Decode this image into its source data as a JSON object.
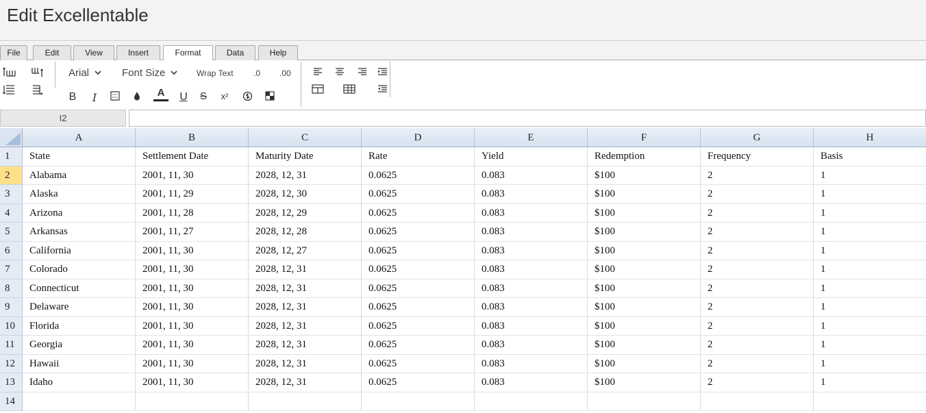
{
  "app": {
    "title": "Edit Excellentable"
  },
  "menu": {
    "tabs": [
      {
        "label": "File"
      },
      {
        "label": "Edit"
      },
      {
        "label": "View"
      },
      {
        "label": "Insert"
      },
      {
        "label": "Format",
        "active": true
      },
      {
        "label": "Data"
      },
      {
        "label": "Help"
      }
    ]
  },
  "toolbar": {
    "font_family": "Arial",
    "font_size": "Font Size",
    "wrap_text": "Wrap Text",
    "decrease_decimal": ".0",
    "increase_decimal": ".00",
    "bold": "B",
    "italic": "I",
    "font_color": "A",
    "underline": "U",
    "strikethrough": "S",
    "superscript": "x²"
  },
  "formula_bar": {
    "cell_ref": "I2",
    "value": ""
  },
  "sheet": {
    "columns": [
      "A",
      "B",
      "C",
      "D",
      "E",
      "F",
      "G",
      "H"
    ],
    "row_numbers": [
      "1",
      "2",
      "3",
      "4",
      "5",
      "6",
      "7",
      "8",
      "9",
      "10",
      "11",
      "12",
      "13",
      "14"
    ],
    "selected_row": "2",
    "rows": [
      [
        "State",
        "Settlement Date",
        "Maturity Date",
        "Rate",
        "Yield",
        "Redemption",
        "Frequency",
        "Basis"
      ],
      [
        "Alabama",
        "2001, 11, 30",
        "2028, 12, 31",
        "0.0625",
        "0.083",
        "$100",
        "2",
        "1"
      ],
      [
        "Alaska",
        "2001, 11, 29",
        "2028, 12, 30",
        "0.0625",
        "0.083",
        "$100",
        "2",
        "1"
      ],
      [
        "Arizona",
        "2001, 11, 28",
        "2028, 12, 29",
        "0.0625",
        "0.083",
        "$100",
        "2",
        "1"
      ],
      [
        "Arkansas",
        "2001, 11, 27",
        "2028, 12, 28",
        "0.0625",
        "0.083",
        "$100",
        "2",
        "1"
      ],
      [
        "California",
        "2001, 11, 30",
        "2028, 12, 27",
        "0.0625",
        "0.083",
        "$100",
        "2",
        "1"
      ],
      [
        "Colorado",
        "2001, 11, 30",
        "2028, 12, 31",
        "0.0625",
        "0.083",
        "$100",
        "2",
        "1"
      ],
      [
        "Connecticut",
        "2001, 11, 30",
        "2028, 12, 31",
        "0.0625",
        "0.083",
        "$100",
        "2",
        "1"
      ],
      [
        "Delaware",
        "2001, 11, 30",
        "2028, 12, 31",
        "0.0625",
        "0.083",
        "$100",
        "2",
        "1"
      ],
      [
        "Florida",
        "2001, 11, 30",
        "2028, 12, 31",
        "0.0625",
        "0.083",
        "$100",
        "2",
        "1"
      ],
      [
        "Georgia",
        "2001, 11, 30",
        "2028, 12, 31",
        "0.0625",
        "0.083",
        "$100",
        "2",
        "1"
      ],
      [
        "Hawaii",
        "2001, 11, 30",
        "2028, 12, 31",
        "0.0625",
        "0.083",
        "$100",
        "2",
        "1"
      ],
      [
        "Idaho",
        "2001, 11, 30",
        "2028, 12, 31",
        "0.0625",
        "0.083",
        "$100",
        "2",
        "1"
      ],
      [
        "",
        "",
        "",
        "",
        "",
        "",
        "",
        ""
      ]
    ]
  },
  "colors": {
    "selected_row_header": "#ffe08a",
    "header_bg": "#dbe5f1"
  }
}
